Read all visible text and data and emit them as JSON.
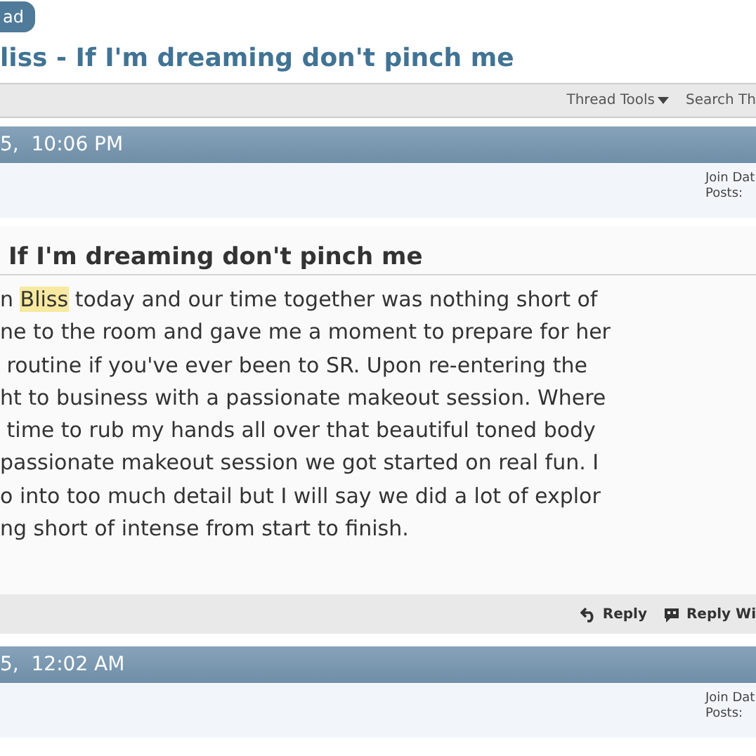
{
  "top_button": {
    "label": "ad"
  },
  "thread_title": "liss - If I'm dreaming don't pinch me",
  "toolbar": [
    {
      "label": "Thread Tools",
      "dropdown": true
    },
    {
      "label": "Search Th",
      "dropdown": false
    }
  ],
  "posts": [
    {
      "time": "5,  10:06 PM",
      "user_info": [
        "Join Dat",
        "Posts:"
      ],
      "title": "If I'm dreaming don't pinch me",
      "lines": [
        [
          {
            "text": "n ",
            "highlighted": false
          },
          {
            "text": "Bliss",
            "highlighted": true
          },
          {
            "text": " today and our time together was nothing short of",
            "highlighted": false
          }
        ],
        [
          {
            "text": "ne to the room and gave me a moment to prepare for her",
            "highlighted": false
          }
        ],
        [
          {
            "text": " routine if you've ever been to SR. Upon re-entering the",
            "highlighted": false
          }
        ],
        [
          {
            "text": "ht to business with a passionate makeout session. Where",
            "highlighted": false
          }
        ],
        [
          {
            "text": " time to rub my hands all over that beautiful toned body",
            "highlighted": false
          }
        ],
        [
          {
            "text": "passionate makeout session we got started on real fun. I",
            "highlighted": false
          }
        ],
        [
          {
            "text": "o into too much detail but I will say we did a lot of explor",
            "highlighted": false
          }
        ],
        [
          {
            "text": "ng short of intense from start to finish.",
            "highlighted": false
          }
        ]
      ],
      "actions": [
        {
          "kind": "reply",
          "label": "Reply"
        },
        {
          "kind": "quote",
          "label": "Reply Wi"
        }
      ]
    },
    {
      "time": "5,  12:02 AM",
      "user_info": [
        "Join Dat",
        "Posts:"
      ]
    }
  ]
}
